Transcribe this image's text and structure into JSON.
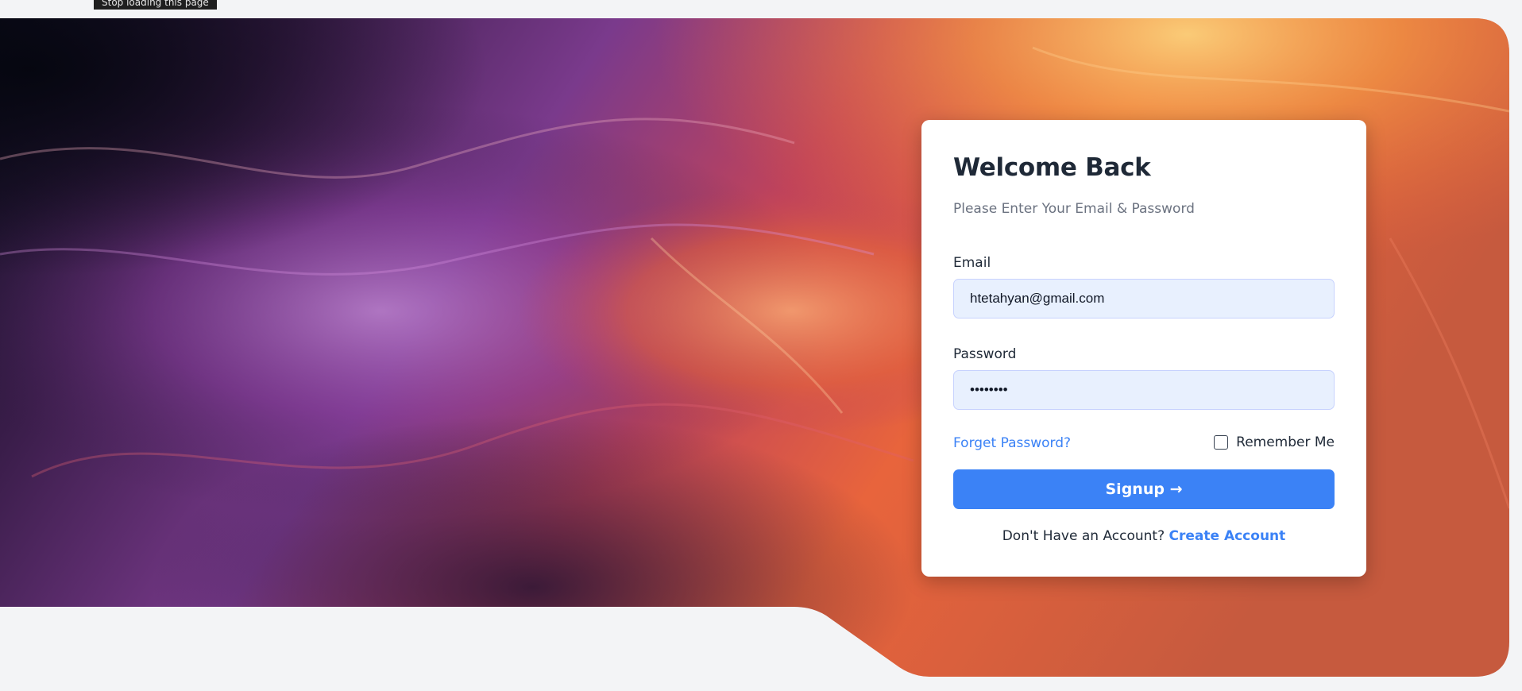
{
  "browser": {
    "tooltip": "Stop loading this page"
  },
  "hero": {
    "background": "abstract-swirl-painting",
    "palette": [
      "#0b0d1c",
      "#3a1d4a",
      "#7a3a8c",
      "#c0435a",
      "#e8643c",
      "#f7a040",
      "#fbd07a"
    ]
  },
  "login": {
    "title": "Welcome Back",
    "subtitle": "Please Enter Your Email & Password",
    "email_label": "Email",
    "email_value": "htetahyan@gmail.com",
    "password_label": "Password",
    "password_value": "••••••••",
    "forgot_label": "Forget Password?",
    "remember_label": "Remember Me",
    "remember_checked": false,
    "signup_label": "Signup →",
    "no_account_text": "Don't Have an Account?",
    "create_account_label": "Create Account",
    "accent_color": "#3b82f6"
  }
}
